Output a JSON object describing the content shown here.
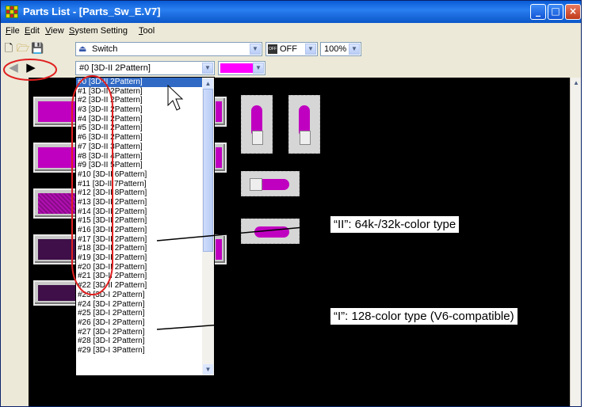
{
  "window": {
    "title": "Parts List - [Parts_Sw_E.V7]"
  },
  "menu": [
    "File",
    "Edit",
    "View",
    "System Setting",
    "Tool"
  ],
  "toolbar": {
    "type_combo": "Switch",
    "state_combo": "OFF",
    "zoom_combo": "100%",
    "state_icon_label": "OFF",
    "color_swatch": "#ff00ff"
  },
  "pattern_combo": {
    "value": "#0 [3D-II 2Pattern]"
  },
  "pattern_list": [
    "#0 [3D-II 2Pattern]",
    "#1 [3D-II 2Pattern]",
    "#2 [3D-II 2Pattern]",
    "#3 [3D-II 2Pattern]",
    "#4 [3D-II 2Pattern]",
    "#5 [3D-II 2Pattern]",
    "#6 [3D-II 2Pattern]",
    "#7 [3D-II 3Pattern]",
    "#8 [3D-II 4Pattern]",
    "#9 [3D-II 5Pattern]",
    "#10 [3D-II 6Pattern]",
    "#11 [3D-II 7Pattern]",
    "#12 [3D-II 8Pattern]",
    "#13 [3D-II 2Pattern]",
    "#14 [3D-II 2Pattern]",
    "#15 [3D-II 2Pattern]",
    "#16 [3D-II 2Pattern]",
    "#17 [3D-II 2Pattern]",
    "#18 [3D-II 2Pattern]",
    "#19 [3D-II 2Pattern]",
    "#20 [3D-II 2Pattern]",
    "#21 [3D-II 2Pattern]",
    "#22 [3D-II 2Pattern]",
    "#23 [3D-I 2Pattern]",
    "#24 [3D-I 2Pattern]",
    "#25 [3D-I 2Pattern]",
    "#26 [3D-I 2Pattern]",
    "#27 [3D-I 2Pattern]",
    "#28 [3D-I 2Pattern]",
    "#29 [3D-I 3Pattern]"
  ],
  "callouts": {
    "ii": "“II”: 64k-/32k-color type",
    "i": "“I”: 128-color type (V6-compatible)"
  },
  "colors": {
    "accent": "#ff00ff",
    "titlebar": "#0a5bd6",
    "highlight": "#e02020",
    "selection": "#316ac5"
  }
}
